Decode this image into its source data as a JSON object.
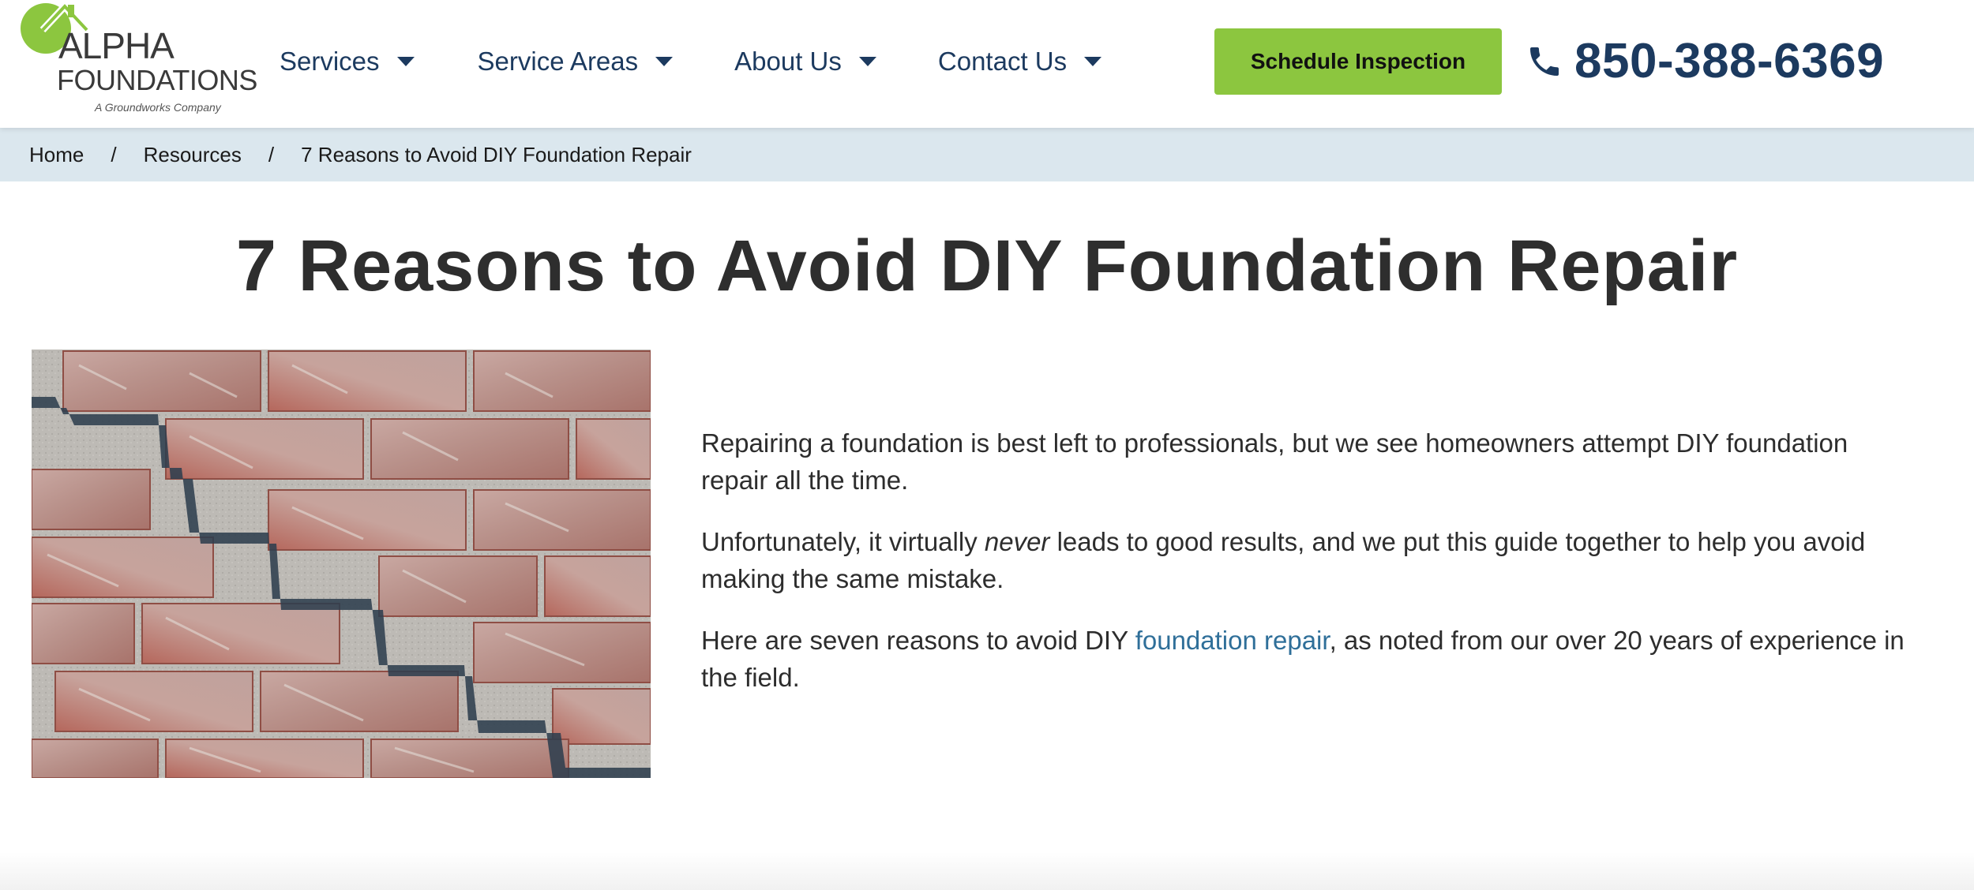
{
  "logo": {
    "line1": "ALPHA",
    "line2": "FOUNDATIONS",
    "tagline": "A Groundworks Company",
    "brand_green": "#8cc63f",
    "text_color": "#3a3a3a"
  },
  "nav": {
    "items": [
      {
        "label": "Services"
      },
      {
        "label": "Service Areas"
      },
      {
        "label": "About Us"
      },
      {
        "label": "Contact Us"
      }
    ],
    "color": "#1c3a5f"
  },
  "cta": {
    "label": "Schedule Inspection",
    "color": "#8cc63f"
  },
  "phone": {
    "icon": "phone-icon",
    "number": "850-388-6369"
  },
  "breadcrumb": {
    "home": "Home",
    "resources": "Resources",
    "current": "7 Reasons to Avoid DIY Foundation Repair",
    "separator": "/",
    "background": "#dbe7ee"
  },
  "article": {
    "title": "7 Reasons to Avoid DIY Foundation Repair",
    "p1": "Repairing a foundation is best left to professionals, but we see homeowners attempt DIY foundation repair all the time.",
    "p2_before": "Unfortunately, it virtually ",
    "p2_emphasis": "never",
    "p2_after": " leads to good results, and we put this guide together to help you avoid making the same mistake.",
    "p3_before": "Here are seven reasons to avoid DIY ",
    "p3_link": "foundation repair",
    "p3_after": ", as noted from our over 20 years of experience in the field.",
    "link_color": "#2f6f99"
  },
  "hero_image": {
    "subject": "cracked brick wall with stair-step crack"
  }
}
